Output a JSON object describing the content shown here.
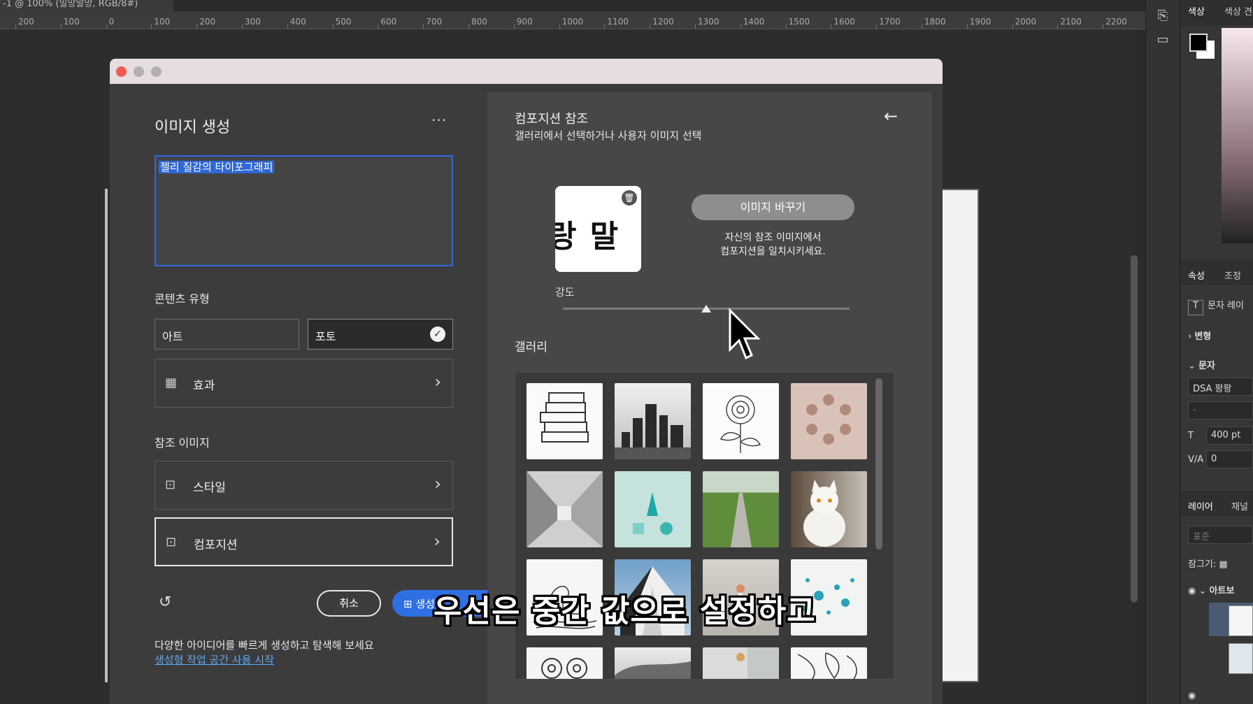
{
  "document_title": "-1 @ 100% (밀망말망, RGB/8#)",
  "ruler_ticks": [
    "200",
    "100",
    "0",
    "100",
    "200",
    "300",
    "400",
    "500",
    "600",
    "700",
    "800",
    "900",
    "1000",
    "1100",
    "1200",
    "1300",
    "1400",
    "1500",
    "1600",
    "1700",
    "1800",
    "1900",
    "2000",
    "2100",
    "2200"
  ],
  "dialog": {
    "left": {
      "title": "이미지 생성",
      "more_label": "···",
      "prompt_text": "젤리 질감의 타이포그래피",
      "content_type_label": "콘텐츠 유형",
      "type_art": "아트",
      "type_photo": "포토",
      "effects_label": "효과",
      "reference_label": "참조 이미지",
      "style_label": "스타일",
      "composition_label": "컴포지션",
      "cancel_label": "취소",
      "generate_label": "생성",
      "hint_text": "다양한 아이디어를 빠르게 생성하고 탐색해 보세요",
      "workspace_link": "생성형 작업 공간 사용 시작"
    },
    "right": {
      "title": "컴포지션 참조",
      "subtitle": "갤러리에서 선택하거나 사용자 이미지 선택",
      "ref_image_text": "랑 말 ",
      "replace_label": "이미지 바꾸기",
      "desc_line1": "자신의 참조 이미지에서",
      "desc_line2": "컴포지션을 일치시키세요.",
      "strength_label": "강도",
      "strength_value": 0.5,
      "gallery_label": "갤러리"
    }
  },
  "caption": "우선은 중간 값으로 설정하고",
  "right_panel": {
    "color_tab": "색상",
    "swatch_tab": "색상 견",
    "props_tab": "속성",
    "adjust_tab": "조정",
    "text_layer": "문자 레이",
    "transform": "변형",
    "character": "문자",
    "font_name": "DSA 팡팡",
    "font_style": "-",
    "font_size": "400 pt",
    "tracking": "0",
    "layers_tab": "레이어",
    "channels_tab": "채널",
    "blend_mode": "표준",
    "lock_label": "잠그기:",
    "artboard_label": "아트보"
  },
  "colors": {
    "accent": "#2f6fe4",
    "dialog_bg": "#3c3c3c",
    "right_bg": "#474747"
  }
}
